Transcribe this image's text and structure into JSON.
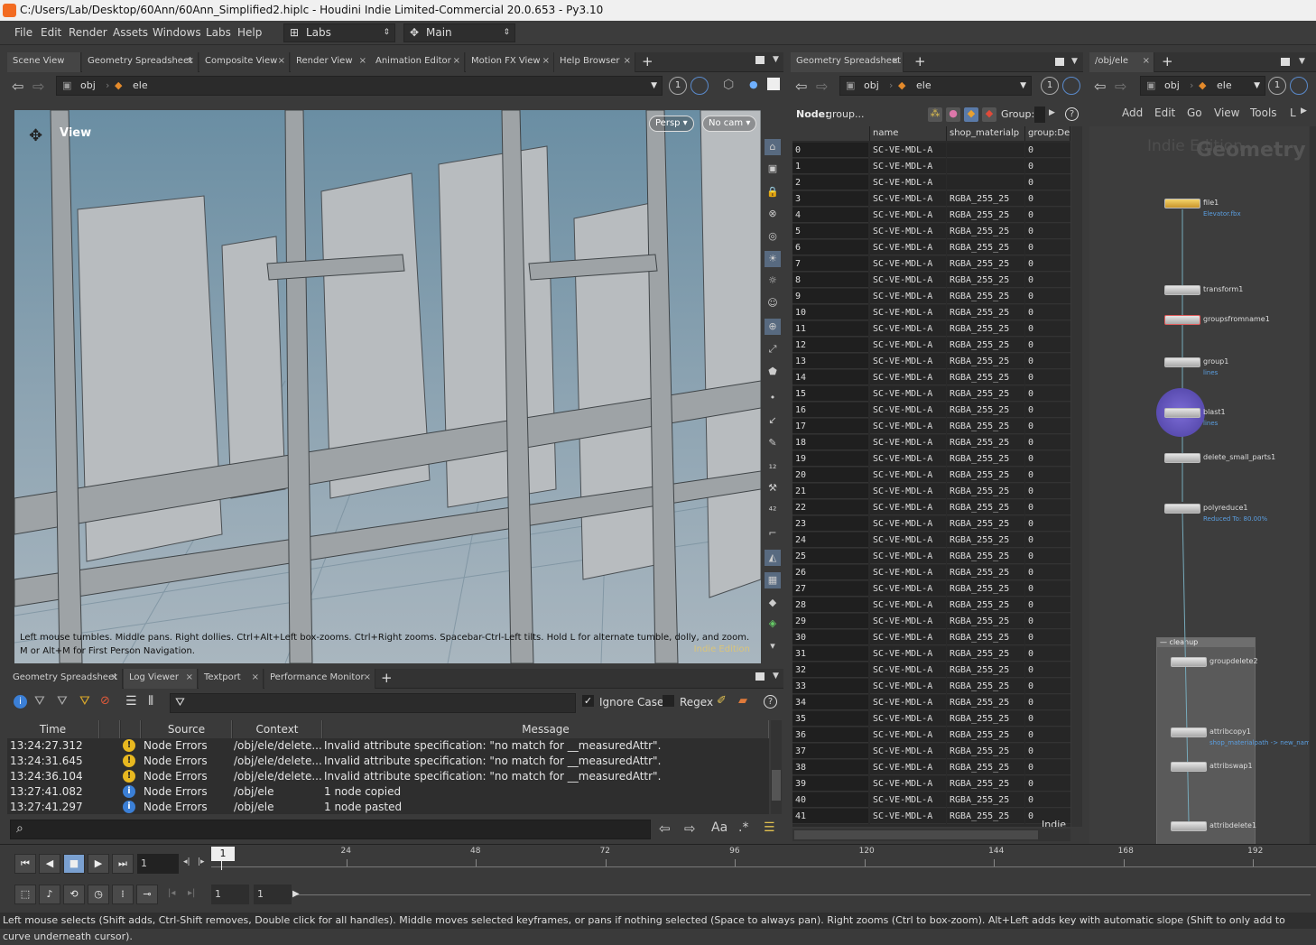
{
  "window": {
    "title": "C:/Users/Lab/Desktop/60Ann/60Ann_Simplified2.hiplc - Houdini Indie Limited-Commercial 20.0.653 - Py3.10"
  },
  "menu": {
    "items": [
      "File",
      "Edit",
      "Render",
      "Assets",
      "Windows",
      "Labs",
      "Help"
    ],
    "desktop": "Labs",
    "main": "Main"
  },
  "left_tabs": [
    "Scene View",
    "Geometry Spreadsheet",
    "Composite View",
    "Render View",
    "Animation Editor",
    "Motion FX View",
    "Help Browser"
  ],
  "path": {
    "obj": "obj",
    "node": "ele",
    "num": "1"
  },
  "viewport": {
    "label": "View",
    "persp": "Persp",
    "cam": "No cam",
    "hint": "Left mouse tumbles. Middle pans. Right dollies. Ctrl+Alt+Left box-zooms. Ctrl+Right zooms. Spacebar-Ctrl-Left tilts. Hold L for alternate tumble, dolly, and zoom. M or Alt+M for First Person Navigation.",
    "watermark": "Indie Edition"
  },
  "bottom_tabs": [
    "Geometry Spreadsheet",
    "Log Viewer",
    "Textport",
    "Performance Monitor"
  ],
  "log": {
    "ignore_case": "Ignore Case",
    "regex": "Regex",
    "headers": [
      "Time",
      "Source",
      "Context",
      "Message"
    ],
    "rows": [
      {
        "time": "13:24:27.312",
        "type": "warn",
        "source": "Node Errors",
        "context": "/obj/ele/delete...",
        "message": "Invalid attribute specification: \"no match for __measuredAttr\"."
      },
      {
        "time": "13:24:31.645",
        "type": "warn",
        "source": "Node Errors",
        "context": "/obj/ele/delete...",
        "message": "Invalid attribute specification: \"no match for __measuredAttr\"."
      },
      {
        "time": "13:24:36.104",
        "type": "warn",
        "source": "Node Errors",
        "context": "/obj/ele/delete...",
        "message": "Invalid attribute specification: \"no match for __measuredAttr\"."
      },
      {
        "time": "13:27:41.082",
        "type": "info",
        "source": "Node Errors",
        "context": "/obj/ele",
        "message": "1 node copied"
      },
      {
        "time": "13:27:41.297",
        "type": "info",
        "source": "Node Errors",
        "context": "/obj/ele",
        "message": "1 node pasted"
      }
    ]
  },
  "spreadsheet": {
    "tab": "Geometry Spreadsheet",
    "node_label": "Node:",
    "node_value": "group...",
    "group_label": "Group:",
    "headers": [
      "",
      "name",
      "shop_materialp",
      "group:De"
    ],
    "name_value": "SC-VE-MDL-A",
    "mat_value": "RGBA_255_25",
    "group_value": "0",
    "rows": [
      "0",
      "1",
      "2",
      "3",
      "4",
      "5",
      "6",
      "7",
      "8",
      "9",
      "10",
      "11",
      "12",
      "13",
      "14",
      "15",
      "16",
      "17",
      "18",
      "19",
      "20",
      "21",
      "22",
      "23",
      "24",
      "25",
      "26",
      "27",
      "28",
      "29",
      "30",
      "31",
      "32",
      "33",
      "34",
      "35",
      "36",
      "37",
      "38",
      "39",
      "40",
      "41"
    ],
    "footer": "Indie"
  },
  "network": {
    "tab": "/obj/ele",
    "menu": [
      "Add",
      "Edit",
      "Go",
      "View",
      "Tools",
      "L"
    ],
    "watermark": "Indie Edition",
    "title": "Geometry",
    "box_label": "cleanup",
    "nodes": [
      {
        "name": "file1",
        "sub": "Elevator.fbx"
      },
      {
        "name": "transform1",
        "sub": ""
      },
      {
        "name": "groupsfromname1",
        "sub": ""
      },
      {
        "name": "group1",
        "sub": "lines"
      },
      {
        "name": "blast1",
        "sub": "lines"
      },
      {
        "name": "delete_small_parts1",
        "sub": ""
      },
      {
        "name": "polyreduce1",
        "sub": "Reduced To: 80.00%"
      },
      {
        "name": "groupdelete2",
        "sub": ""
      },
      {
        "name": "attribcopy1",
        "sub": "shop_materialpath -> new_nam"
      },
      {
        "name": "attribswap1",
        "sub": ""
      },
      {
        "name": "attribdelete1",
        "sub": ""
      }
    ]
  },
  "timeline": {
    "ticks": [
      "24",
      "48",
      "72",
      "96",
      "120",
      "144",
      "168",
      "192"
    ],
    "current": "1",
    "frame": "1",
    "start": "1",
    "end": "1"
  },
  "status": "Left mouse selects (Shift adds, Ctrl-Shift removes, Double click for all handles). Middle moves selected keyframes, or pans if nothing selected (Space to always pan). Right zooms (Ctrl to box-zoom). Alt+Left adds key with automatic slope (Shift to only add to curve underneath cursor)."
}
